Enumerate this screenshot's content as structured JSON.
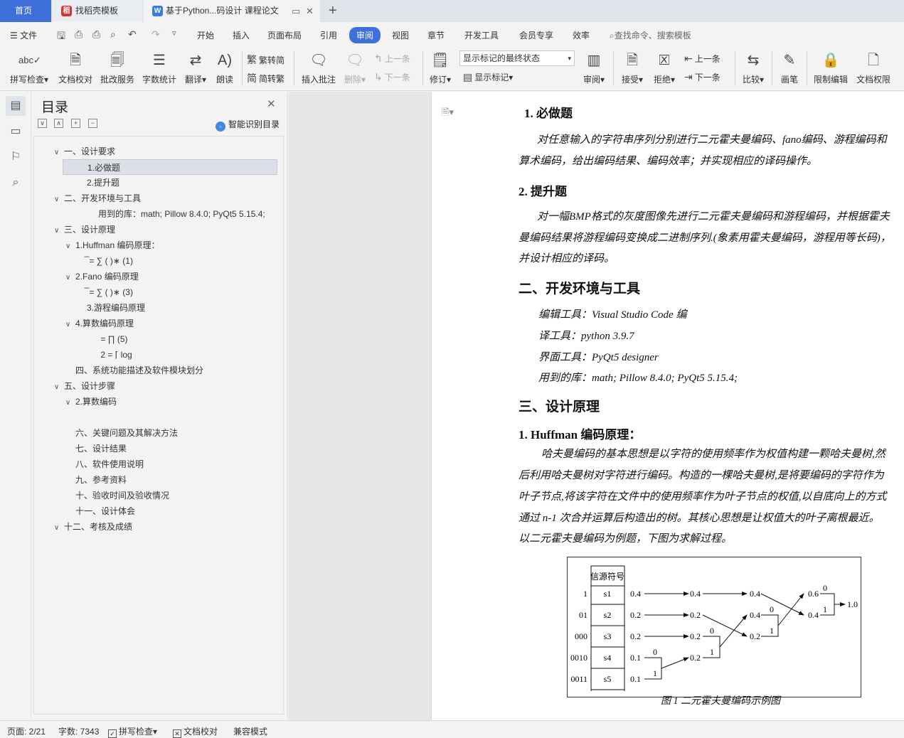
{
  "tabs": [
    {
      "label": "首页"
    },
    {
      "label": "找稻壳模板",
      "icon": "daoke-icon"
    },
    {
      "label": "基于Python...码设计 课程论文",
      "icon": "wps-writer-icon"
    }
  ],
  "menubar": {
    "file": "文件",
    "items": [
      "开始",
      "插入",
      "页面布局",
      "引用",
      "审阅",
      "视图",
      "章节",
      "开发工具",
      "会员专享",
      "效率"
    ],
    "active": "审阅",
    "search_placeholder": "查找命令、搜索模板"
  },
  "ribbon": {
    "spell_check": "拼写检查",
    "doc_proof": "文档校对",
    "review_service": "批改服务",
    "word_count": "字数统计",
    "translate": "翻译",
    "read_aloud": "朗读",
    "trad_to_simp": "繁转简",
    "simp_to_trad": "简转繁",
    "insert_comment": "插入批注",
    "delete": "删除",
    "prev_comment": "上一条",
    "next_comment": "下一条",
    "track_changes": "修订",
    "markup_state": "显示标记的最终状态",
    "show_markup": "显示标记",
    "review_pane": "审阅",
    "accept": "接受",
    "reject": "拒绝",
    "prev_change": "上一条",
    "next_change": "下一条",
    "compare": "比较",
    "pen": "画笔",
    "restrict_edit": "限制编辑",
    "doc_permission": "文档权限"
  },
  "toc": {
    "title": "目录",
    "smart_label": "智能识别目录",
    "items": [
      {
        "text": "一、设计要求",
        "chev": "∨"
      },
      {
        "text": "1.必做题",
        "chev": ""
      },
      {
        "text": "2.提升题",
        "chev": ""
      },
      {
        "text": "二、开发环境与工具",
        "chev": "∨"
      },
      {
        "text": "用到的库：math; Pillow 8.4.0; PyQt5 5.15.4;",
        "chev": ""
      },
      {
        "text": "三、设计原理",
        "chev": "∨"
      },
      {
        "text": "1.Huffman 编码原理：",
        "chev": "∨"
      },
      {
        "text": "̅ = ∑ ( )∗    (1)",
        "chev": ""
      },
      {
        "text": "2.Fano 编码原理",
        "chev": "∨"
      },
      {
        "text": "̅ = ∑ ( )∗    (3)",
        "chev": ""
      },
      {
        "text": "3.游程编码原理",
        "chev": ""
      },
      {
        "text": "4.算数编码原理",
        "chev": "∨"
      },
      {
        "text": " = ∏     (5)",
        "chev": ""
      },
      {
        "text": "      2 = ⌈ log",
        "chev": ""
      },
      {
        "text": "四、系统功能描述及软件模块划分",
        "chev": ""
      },
      {
        "text": "五、设计步骤",
        "chev": "∨"
      },
      {
        "text": "2.算数编码",
        "chev": "∨"
      },
      {
        "text": "六、关键问题及其解决方法",
        "chev": ""
      },
      {
        "text": "七、设计结果",
        "chev": ""
      },
      {
        "text": "八、软件使用说明",
        "chev": ""
      },
      {
        "text": "九、参考资料",
        "chev": ""
      },
      {
        "text": "十、验收时间及验收情况",
        "chev": ""
      },
      {
        "text": "十一、设计体会",
        "chev": ""
      },
      {
        "text": "十二、考核及成绩",
        "chev": "∨"
      }
    ],
    "selected_index": 1
  },
  "document": {
    "lines": [
      "1.  必做题",
      "对任意输入的字符串序列分别进行二元霍夫曼编码、fano编码、游程编码和",
      "算术编码，给出编码结果、编码效率；并实现相应的译码操作。",
      "2.  提升题",
      "对一幅BMP格式的灰度图像先进行二元霍夫曼编码和游程编码，并根据霍夫",
      "曼编码结果将游程编码变换成二进制序列.(象素用霍夫曼编码，游程用等长码)，",
      "并设计相应的译码。",
      "二、开发环境与工具",
      "编辑工具：Visual Studio Code 编",
      "译工具：python 3.9.7",
      "界面工具：PyQt5 designer",
      "用到的库：math; Pillow 8.4.0; PyQt5 5.15.4;",
      "三、设计原理",
      "1.    Huffman 编码原理：",
      "哈夫曼编码的基本思想是以字符的使用频率作为权值构建一颗哈夫曼树,然",
      "后利用哈夫曼树对字符进行编码。构造的一棵哈夫曼树,是将要编码的字符作为",
      "叶子节点,将该字符在文件中的使用频率作为叶子节点的权值,以自底向上的方式",
      "通过 n-1 次合并运算后构造出的树。其核心思想是让权值大的叶子离根最近。",
      "以二元霍夫曼编码为例题，下图为求解过程。"
    ],
    "figure": {
      "header": "信源符号",
      "codes": [
        "1",
        "01",
        "000",
        "0010",
        "0011"
      ],
      "symbols": [
        "s1",
        "s2",
        "s3",
        "s4",
        "s5"
      ],
      "col1": [
        "0.4",
        "0.2",
        "0.2",
        "0.1",
        "0.1"
      ],
      "col2": [
        "0.4",
        "0.2",
        "0.2",
        "0.2"
      ],
      "col3": [
        "0.4",
        "0.4",
        "0.2"
      ],
      "col4": [
        "0.6",
        "0.4"
      ],
      "root": "1.0",
      "bits": [
        "0",
        "1"
      ]
    },
    "caption": "图 1  二元霍夫曼编码示例图"
  },
  "status": {
    "page": "页面: 2/21",
    "words": "字数: 7343",
    "spell": "拼写检查",
    "proof": "文档校对",
    "compat": "兼容模式"
  }
}
